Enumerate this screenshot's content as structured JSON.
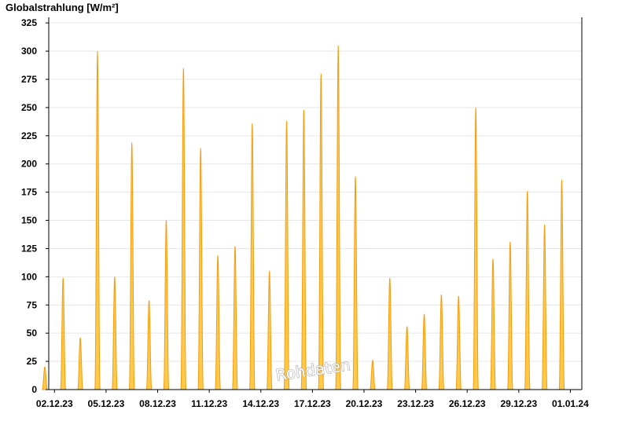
{
  "chart_data": {
    "type": "area",
    "title": "Globalstrahlung [W/m²]",
    "watermark": "Rohdaten",
    "xlabel": "",
    "ylabel": "",
    "ylim": [
      0,
      330
    ],
    "yticks": [
      0,
      25,
      50,
      75,
      100,
      125,
      150,
      175,
      200,
      225,
      250,
      275,
      300,
      325
    ],
    "xlim": [
      "2023-12-01T16:00",
      "2024-01-01T16:00"
    ],
    "xticks": [
      {
        "date": "2023-12-02",
        "label": "02.12.23"
      },
      {
        "date": "2023-12-05",
        "label": "05.12.23"
      },
      {
        "date": "2023-12-08",
        "label": "08.12.23"
      },
      {
        "date": "2023-12-11",
        "label": "11.12.23"
      },
      {
        "date": "2023-12-14",
        "label": "14.12.23"
      },
      {
        "date": "2023-12-17",
        "label": "17.12.23"
      },
      {
        "date": "2023-12-20",
        "label": "20.12.23"
      },
      {
        "date": "2023-12-23",
        "label": "23.12.23"
      },
      {
        "date": "2023-12-26",
        "label": "26.12.23"
      },
      {
        "date": "2023-12-29",
        "label": "29.12.23"
      },
      {
        "date": "2024-01-01",
        "label": "01.01.24"
      }
    ],
    "grid": true,
    "colors": {
      "fill": "#ffc94a",
      "line": "#f39c12",
      "grid": "#e6e6e6"
    },
    "series": [
      {
        "peaks": [
          {
            "date": "2023-12-01",
            "time": "10:30",
            "value": 20
          },
          {
            "date": "2023-12-02",
            "time": "12:00",
            "value": 99
          },
          {
            "date": "2023-12-03",
            "time": "12:00",
            "value": 46
          },
          {
            "date": "2023-12-04",
            "time": "12:00",
            "value": 300
          },
          {
            "date": "2023-12-05",
            "time": "12:00",
            "value": 100
          },
          {
            "date": "2023-12-06",
            "time": "12:00",
            "value": 219
          },
          {
            "date": "2023-12-07",
            "time": "12:00",
            "value": 79
          },
          {
            "date": "2023-12-08",
            "time": "12:00",
            "value": 150
          },
          {
            "date": "2023-12-09",
            "time": "12:00",
            "value": 285
          },
          {
            "date": "2023-12-10",
            "time": "12:00",
            "value": 214
          },
          {
            "date": "2023-12-11",
            "time": "12:00",
            "value": 119
          },
          {
            "date": "2023-12-12",
            "time": "12:00",
            "value": 127
          },
          {
            "date": "2023-12-13",
            "time": "12:00",
            "value": 236
          },
          {
            "date": "2023-12-14",
            "time": "12:00",
            "value": 105
          },
          {
            "date": "2023-12-15",
            "time": "12:00",
            "value": 238
          },
          {
            "date": "2023-12-16",
            "time": "12:00",
            "value": 248
          },
          {
            "date": "2023-12-17",
            "time": "12:00",
            "value": 280
          },
          {
            "date": "2023-12-18",
            "time": "12:00",
            "value": 305
          },
          {
            "date": "2023-12-19",
            "time": "12:00",
            "value": 189
          },
          {
            "date": "2023-12-20",
            "time": "12:00",
            "value": 26
          },
          {
            "date": "2023-12-21",
            "time": "12:00",
            "value": 99
          },
          {
            "date": "2023-12-22",
            "time": "12:00",
            "value": 56
          },
          {
            "date": "2023-12-23",
            "time": "12:00",
            "value": 67
          },
          {
            "date": "2023-12-24",
            "time": "12:00",
            "value": 84
          },
          {
            "date": "2023-12-25",
            "time": "12:00",
            "value": 83
          },
          {
            "date": "2023-12-26",
            "time": "12:00",
            "value": 250
          },
          {
            "date": "2023-12-27",
            "time": "12:00",
            "value": 116
          },
          {
            "date": "2023-12-28",
            "time": "12:00",
            "value": 131
          },
          {
            "date": "2023-12-29",
            "time": "12:00",
            "value": 176
          },
          {
            "date": "2023-12-30",
            "time": "12:00",
            "value": 146
          },
          {
            "date": "2023-12-31",
            "time": "12:00",
            "value": 186
          }
        ]
      }
    ]
  }
}
